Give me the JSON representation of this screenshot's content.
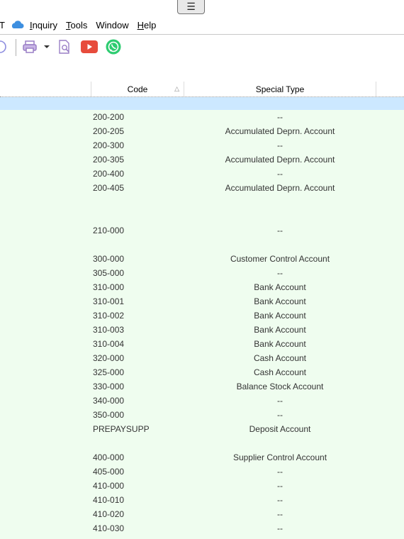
{
  "hamburger": {
    "glyph": "☰"
  },
  "menu": {
    "items": [
      {
        "label": "T",
        "accel": ""
      },
      {
        "label": "nquiry",
        "accel": "I"
      },
      {
        "label": "ools",
        "accel": "T"
      },
      {
        "label": "Window",
        "accel": ""
      },
      {
        "label": "elp",
        "accel": "H"
      }
    ]
  },
  "toolbar": {
    "icons": [
      "refresh-icon",
      "print-icon",
      "dropdown-arrow-icon",
      "print-preview-icon",
      "youtube-icon",
      "whatsapp-icon"
    ],
    "colors": {
      "youtube": "#e74c3c",
      "whatsapp": "#2ecc71",
      "print": "#9a7fc6"
    }
  },
  "grid": {
    "columns": [
      {
        "label": "Code",
        "sorted": "ascending"
      },
      {
        "label": "Special Type"
      }
    ],
    "colors": {
      "row_background": "#effdef",
      "selected_row": "#cce8ff"
    },
    "rows": [
      {
        "code": "200-200",
        "special_type": "--"
      },
      {
        "code": "200-205",
        "special_type": "Accumulated Deprn. Account"
      },
      {
        "code": "200-300",
        "special_type": "--"
      },
      {
        "code": "200-305",
        "special_type": "Accumulated Deprn. Account"
      },
      {
        "code": "200-400",
        "special_type": "--"
      },
      {
        "code": "200-405",
        "special_type": "Accumulated Deprn. Account"
      },
      {
        "code": "",
        "special_type": ""
      },
      {
        "code": "",
        "special_type": ""
      },
      {
        "code": "210-000",
        "special_type": "--"
      },
      {
        "code": "",
        "special_type": ""
      },
      {
        "code": "300-000",
        "special_type": "Customer Control Account"
      },
      {
        "code": "305-000",
        "special_type": "--"
      },
      {
        "code": "310-000",
        "special_type": "Bank Account"
      },
      {
        "code": "310-001",
        "special_type": "Bank Account"
      },
      {
        "code": "310-002",
        "special_type": "Bank Account"
      },
      {
        "code": "310-003",
        "special_type": "Bank Account"
      },
      {
        "code": "310-004",
        "special_type": "Bank Account"
      },
      {
        "code": "320-000",
        "special_type": "Cash Account"
      },
      {
        "code": "325-000",
        "special_type": "Cash Account"
      },
      {
        "code": "330-000",
        "special_type": "Balance Stock Account"
      },
      {
        "code": "340-000",
        "special_type": "--"
      },
      {
        "code": "350-000",
        "special_type": "--"
      },
      {
        "code": "PREPAYSUPP",
        "special_type": "Deposit Account"
      },
      {
        "code": "",
        "special_type": ""
      },
      {
        "code": "400-000",
        "special_type": "Supplier Control Account"
      },
      {
        "code": "405-000",
        "special_type": "--"
      },
      {
        "code": "410-000",
        "special_type": "--"
      },
      {
        "code": "410-010",
        "special_type": "--"
      },
      {
        "code": "410-020",
        "special_type": "--"
      },
      {
        "code": "410-030",
        "special_type": "--"
      }
    ]
  }
}
